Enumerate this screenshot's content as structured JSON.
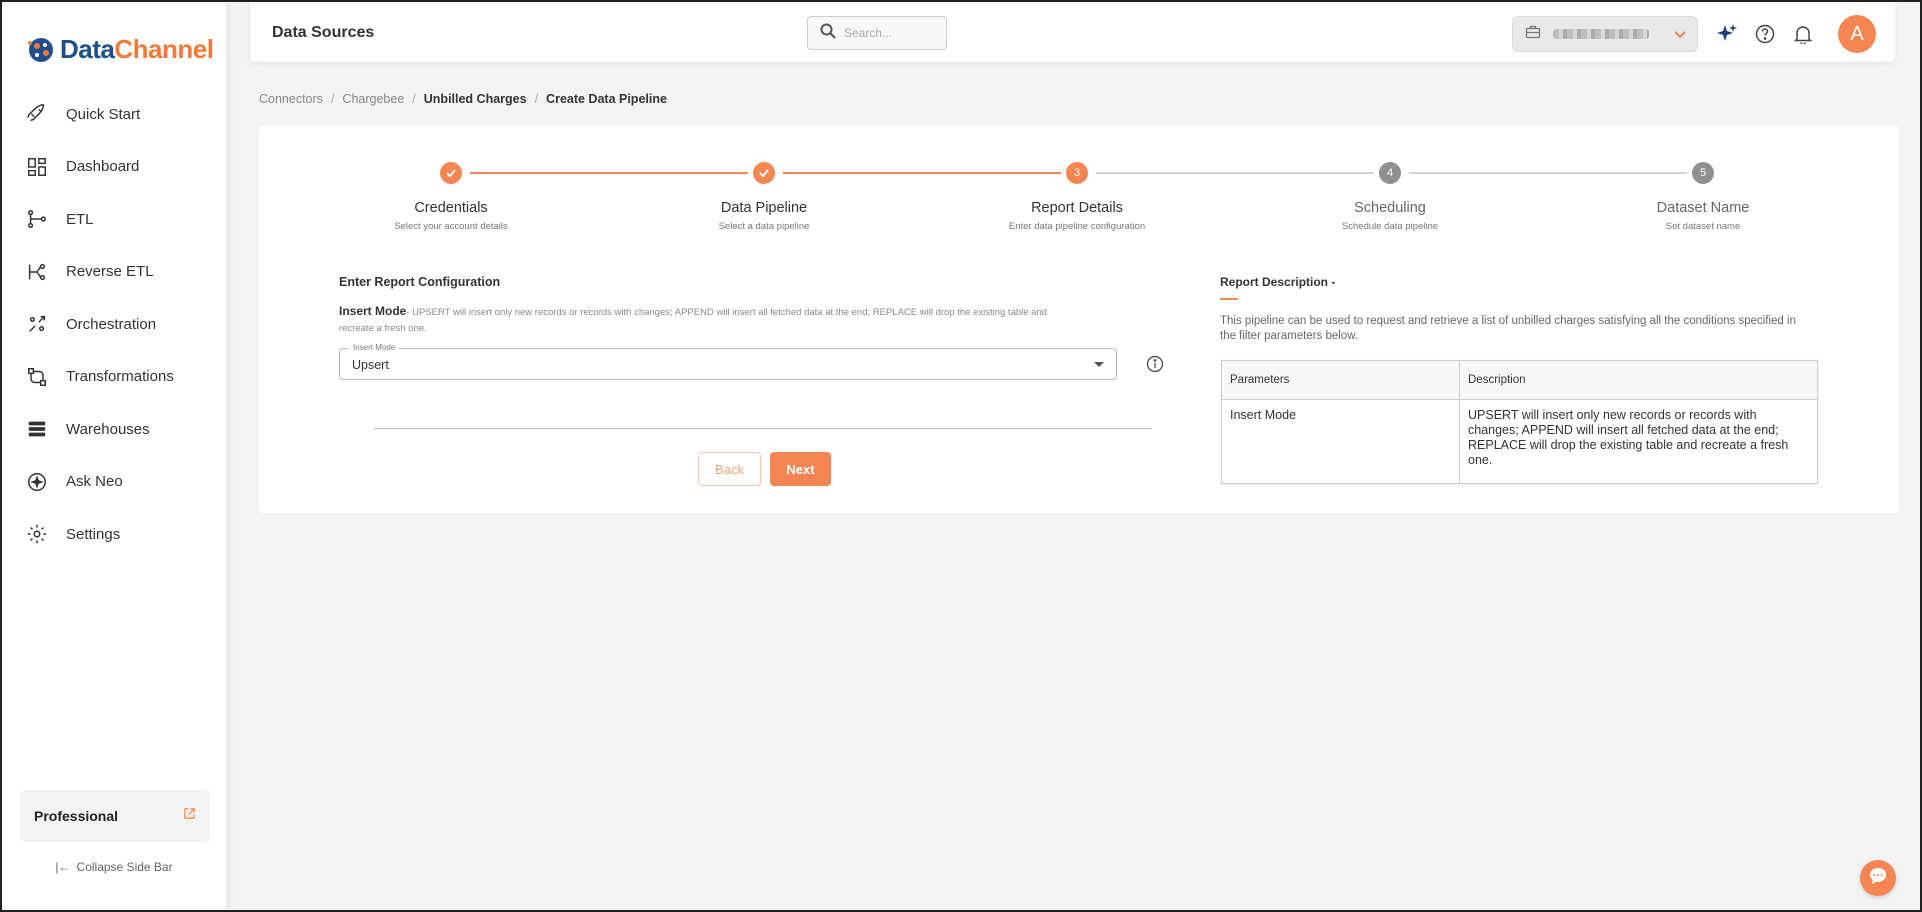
{
  "brand": {
    "name_part1": "Data",
    "name_part2": "Channel",
    "primary_color": "#1f4e8c",
    "accent_color": "#f58553"
  },
  "sidebar": {
    "items": [
      {
        "label": "Quick Start",
        "icon": "rocket-icon"
      },
      {
        "label": "Dashboard",
        "icon": "dashboard-icon"
      },
      {
        "label": "ETL",
        "icon": "etl-icon"
      },
      {
        "label": "Reverse ETL",
        "icon": "reverse-etl-icon"
      },
      {
        "label": "Orchestration",
        "icon": "orchestration-icon"
      },
      {
        "label": "Transformations",
        "icon": "transformations-icon"
      },
      {
        "label": "Warehouses",
        "icon": "warehouses-icon"
      },
      {
        "label": "Ask Neo",
        "icon": "ask-neo-icon"
      },
      {
        "label": "Settings",
        "icon": "settings-icon"
      }
    ],
    "plan_label": "Professional",
    "collapse_label": "Collapse Side Bar"
  },
  "header": {
    "title": "Data Sources",
    "search_placeholder": "Search...",
    "avatar_initial": "A"
  },
  "breadcrumb": {
    "items": [
      "Connectors",
      "Chargebee",
      "Unbilled Charges",
      "Create Data Pipeline"
    ],
    "separator": "/"
  },
  "stepper": {
    "current_step": 3,
    "steps": [
      {
        "title": "Credentials",
        "subtitle": "Select your account details",
        "status": "completed"
      },
      {
        "title": "Data Pipeline",
        "subtitle": "Select a data pipeline",
        "status": "completed"
      },
      {
        "title": "Report Details",
        "subtitle": "Enter data pipeline configuration",
        "status": "active",
        "number": "3"
      },
      {
        "title": "Scheduling",
        "subtitle": "Schedule data pipeline",
        "status": "pending",
        "number": "4"
      },
      {
        "title": "Dataset Name",
        "subtitle": "Set dataset name",
        "status": "pending",
        "number": "5"
      }
    ]
  },
  "config": {
    "heading": "Enter Report Configuration",
    "insert_mode_label": "Insert Mode",
    "insert_mode_help": "- UPSERT will insert only new records or records with changes; APPEND will insert all fetched data at the end; REPLACE will drop the existing table and recreate a fresh one.",
    "select_legend": "Insert Mode",
    "select_value": "Upsert",
    "back_label": "Back",
    "next_label": "Next"
  },
  "description": {
    "title": "Report Description -",
    "text": "This pipeline can be used to request and retrieve a list of unbilled charges satisfying all the conditions specified in the filter parameters below.",
    "table": {
      "headers": [
        "Parameters",
        "Description"
      ],
      "rows": [
        {
          "parameter": "Insert Mode",
          "description": "UPSERT will insert only new records or records with changes; APPEND will insert all fetched data at the end; REPLACE will drop the existing table and recreate a fresh one."
        }
      ]
    }
  }
}
